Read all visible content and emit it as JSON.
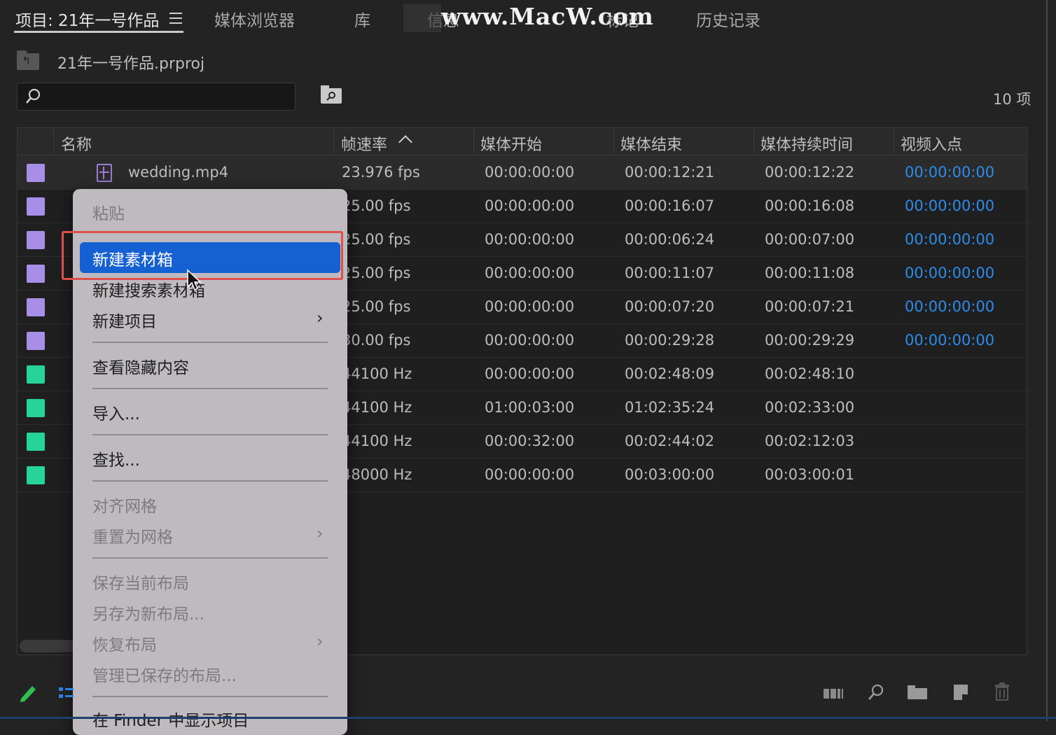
{
  "tabs": [
    {
      "label": "项目: 21年一号作品",
      "active": true
    },
    {
      "label": "媒体浏览器",
      "active": false
    },
    {
      "label": "库",
      "active": false
    },
    {
      "label": "信息",
      "active": false
    },
    {
      "label": "标记",
      "active": false
    },
    {
      "label": "历史记录",
      "active": false
    }
  ],
  "watermark": "www.MacW.com",
  "project": {
    "filename": "21年一号作品.prproj"
  },
  "search": {
    "placeholder": "",
    "value": ""
  },
  "item_count": "10 项",
  "columns": [
    "名称",
    "帧速率",
    "媒体开始",
    "媒体结束",
    "媒体持续时间",
    "视频入点"
  ],
  "sort": {
    "column": "帧速率",
    "direction": "ascending"
  },
  "colors": {
    "video_label": "#a98ee8",
    "audio_label": "#26d49a",
    "link_blue": "#2d8ceb",
    "menu_highlight": "#1560d3",
    "callout_red": "#e0504a"
  },
  "rows": [
    {
      "name": "wedding.mp4",
      "type": "video",
      "fps": "23.976 fps",
      "start": "00:00:00:00",
      "end": "00:00:12:21",
      "duration": "00:00:12:22",
      "video_in": "00:00:00:00"
    },
    {
      "name": "",
      "type": "video",
      "fps": "25.00 fps",
      "start": "00:00:00:00",
      "end": "00:00:16:07",
      "duration": "00:00:16:08",
      "video_in": "00:00:00:00"
    },
    {
      "name": "",
      "type": "video",
      "fps": "25.00 fps",
      "start": "00:00:00:00",
      "end": "00:00:06:24",
      "duration": "00:00:07:00",
      "video_in": "00:00:00:00"
    },
    {
      "name": "",
      "type": "video",
      "fps": "25.00 fps",
      "start": "00:00:00:00",
      "end": "00:00:11:07",
      "duration": "00:00:11:08",
      "video_in": "00:00:00:00"
    },
    {
      "name": "",
      "type": "video",
      "fps": "25.00 fps",
      "start": "00:00:00:00",
      "end": "00:00:07:20",
      "duration": "00:00:07:21",
      "video_in": "00:00:00:00"
    },
    {
      "name": "",
      "type": "video",
      "fps": "30.00 fps",
      "start": "00:00:00:00",
      "end": "00:00:29:28",
      "duration": "00:00:29:29",
      "video_in": "00:00:00:00"
    },
    {
      "name": "",
      "type": "audio",
      "fps": "44100 Hz",
      "start": "00:00:00:00",
      "end": "00:02:48:09",
      "duration": "00:02:48:10",
      "video_in": ""
    },
    {
      "name": "",
      "type": "audio",
      "fps": "44100 Hz",
      "start": "01:00:03:00",
      "end": "01:02:35:24",
      "duration": "00:02:33:00",
      "video_in": ""
    },
    {
      "name": "",
      "type": "audio",
      "fps": "44100 Hz",
      "start": "00:00:32:00",
      "end": "00:02:44:02",
      "duration": "00:02:12:03",
      "video_in": ""
    },
    {
      "name": "",
      "type": "audio",
      "fps": "48000 Hz",
      "start": "00:00:00:00",
      "end": "00:03:00:00",
      "duration": "00:03:00:01",
      "video_in": ""
    }
  ],
  "context_menu": {
    "paste": "粘贴",
    "new_bin": "新建素材箱",
    "new_search_bin": "新建搜索素材箱",
    "new_item": "新建项目",
    "view_hidden": "查看隐藏内容",
    "import": "导入...",
    "find": "查找...",
    "align_grid": "对齐网格",
    "reset_grid": "重置为网格",
    "save_layout": "保存当前布局",
    "save_new_layout": "另存为新布局...",
    "restore_layout": "恢复布局",
    "manage_layouts": "管理已保存的布局...",
    "reveal_finder": "在 Finder 中显示项目",
    "highlighted": "新建素材箱"
  },
  "icons": [
    "hamburger-icon",
    "project-folder-icon",
    "search-icon",
    "bin-search-icon",
    "film-icon",
    "pencil-icon",
    "list-view-icon",
    "storyboard-icon",
    "find-icon",
    "new-bin-icon",
    "new-item-icon",
    "trash-icon",
    "chevron-right-icon",
    "cursor-icon"
  ]
}
